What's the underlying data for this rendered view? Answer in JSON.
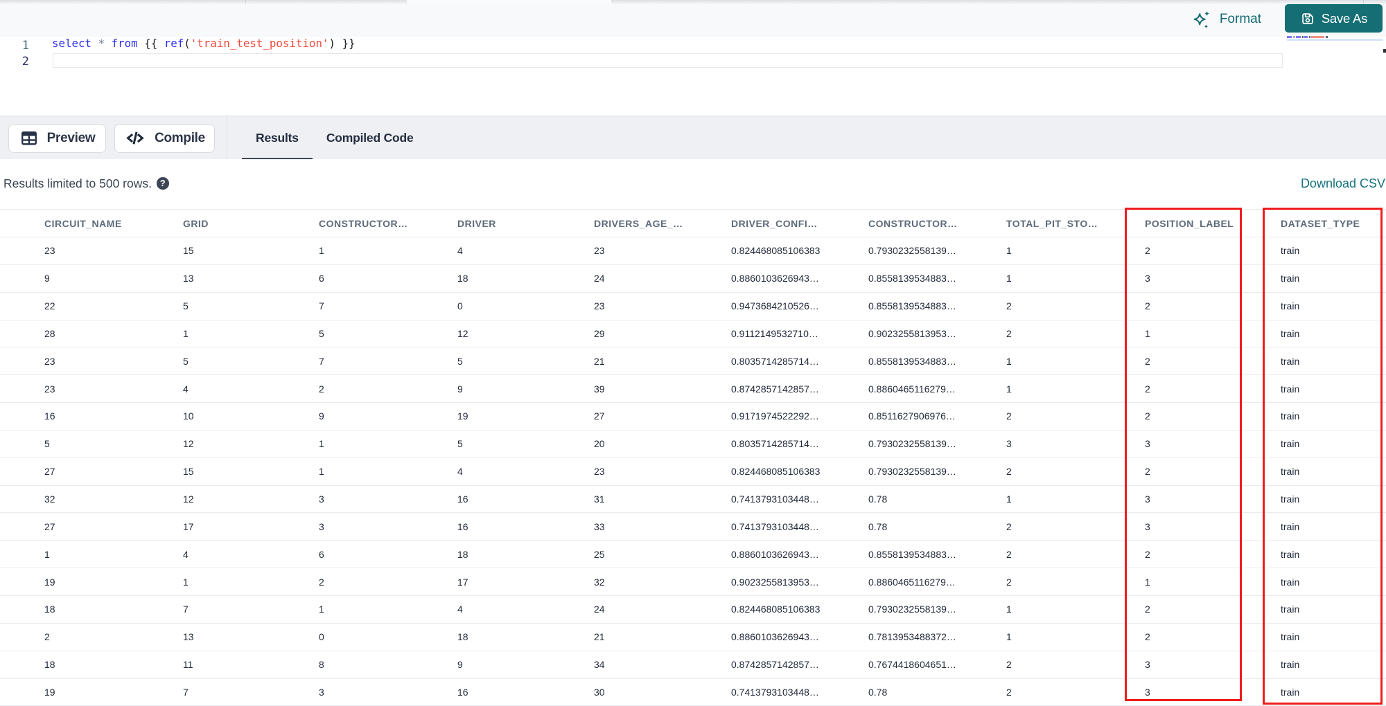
{
  "accent": {
    "teal": "#156e74",
    "red": "#ee1c1c"
  },
  "toolbar": {
    "format_label": "Format",
    "save_as_label": "Save As"
  },
  "editor": {
    "line_numbers": [
      "1",
      "2"
    ],
    "code_line": [
      {
        "text": "select",
        "type": "keyword"
      },
      {
        "text": " ",
        "type": "plain"
      },
      {
        "text": "*",
        "type": "operator"
      },
      {
        "text": " ",
        "type": "plain"
      },
      {
        "text": "from",
        "type": "keyword"
      },
      {
        "text": " ",
        "type": "plain"
      },
      {
        "text": "{{",
        "type": "brace"
      },
      {
        "text": " ",
        "type": "plain"
      },
      {
        "text": "ref",
        "type": "function"
      },
      {
        "text": "(",
        "type": "paren"
      },
      {
        "text": "'train_test_position'",
        "type": "string"
      },
      {
        "text": ")",
        "type": "paren"
      },
      {
        "text": " ",
        "type": "plain"
      },
      {
        "text": "}}",
        "type": "brace"
      }
    ]
  },
  "actions": {
    "preview_label": "Preview",
    "compile_label": "Compile"
  },
  "results_tabs": [
    {
      "label": "Results",
      "active": true
    },
    {
      "label": "Compiled Code",
      "active": false
    }
  ],
  "results_bar": {
    "note": "Results limited to 500 rows.",
    "help_glyph": "?",
    "download_label": "Download CSV"
  },
  "table": {
    "columns": [
      "CIRCUIT_NAME",
      "GRID",
      "CONSTRUCTOR…",
      "DRIVER",
      "DRIVERS_AGE_…",
      "DRIVER_CONFI…",
      "CONSTRUCTOR…",
      "TOTAL_PIT_STO…",
      "POSITION_LABEL",
      "DATASET_TYPE"
    ],
    "rows": [
      [
        "23",
        "15",
        "1",
        "4",
        "23",
        "0.824468085106383",
        "0.7930232558139…",
        "1",
        "2",
        "train"
      ],
      [
        "9",
        "13",
        "6",
        "18",
        "24",
        "0.8860103626943…",
        "0.8558139534883…",
        "1",
        "3",
        "train"
      ],
      [
        "22",
        "5",
        "7",
        "0",
        "23",
        "0.9473684210526…",
        "0.8558139534883…",
        "2",
        "2",
        "train"
      ],
      [
        "28",
        "1",
        "5",
        "12",
        "29",
        "0.9112149532710…",
        "0.9023255813953…",
        "2",
        "1",
        "train"
      ],
      [
        "23",
        "5",
        "7",
        "5",
        "21",
        "0.8035714285714…",
        "0.8558139534883…",
        "1",
        "2",
        "train"
      ],
      [
        "23",
        "4",
        "2",
        "9",
        "39",
        "0.8742857142857…",
        "0.8860465116279…",
        "1",
        "2",
        "train"
      ],
      [
        "16",
        "10",
        "9",
        "19",
        "27",
        "0.9171974522292…",
        "0.8511627906976…",
        "2",
        "2",
        "train"
      ],
      [
        "5",
        "12",
        "1",
        "5",
        "20",
        "0.8035714285714…",
        "0.7930232558139…",
        "3",
        "3",
        "train"
      ],
      [
        "27",
        "15",
        "1",
        "4",
        "23",
        "0.824468085106383",
        "0.7930232558139…",
        "2",
        "2",
        "train"
      ],
      [
        "32",
        "12",
        "3",
        "16",
        "31",
        "0.7413793103448…",
        "0.78",
        "1",
        "3",
        "train"
      ],
      [
        "27",
        "17",
        "3",
        "16",
        "33",
        "0.7413793103448…",
        "0.78",
        "2",
        "3",
        "train"
      ],
      [
        "1",
        "4",
        "6",
        "18",
        "25",
        "0.8860103626943…",
        "0.8558139534883…",
        "2",
        "2",
        "train"
      ],
      [
        "19",
        "1",
        "2",
        "17",
        "32",
        "0.9023255813953…",
        "0.8860465116279…",
        "2",
        "1",
        "train"
      ],
      [
        "18",
        "7",
        "1",
        "4",
        "24",
        "0.824468085106383",
        "0.7930232558139…",
        "1",
        "2",
        "train"
      ],
      [
        "2",
        "13",
        "0",
        "18",
        "21",
        "0.8860103626943…",
        "0.7813953488372…",
        "1",
        "2",
        "train"
      ],
      [
        "18",
        "11",
        "8",
        "9",
        "34",
        "0.8742857142857…",
        "0.7674418604651…",
        "2",
        "3",
        "train"
      ],
      [
        "19",
        "7",
        "3",
        "16",
        "30",
        "0.7413793103448…",
        "0.78",
        "2",
        "3",
        "train"
      ]
    ]
  },
  "annotations": {
    "highlighted_columns": [
      "POSITION_LABEL",
      "DATASET_TYPE"
    ]
  },
  "minimap": {
    "segments": [
      {
        "w": 7,
        "c": "#7b7bf0"
      },
      {
        "w": 3,
        "c": "#aab4c4"
      },
      {
        "w": 7,
        "c": "#7b7bf0"
      },
      {
        "w": 2,
        "c": "#5a6472"
      },
      {
        "w": 5,
        "c": "#7b7bf0"
      },
      {
        "w": 2,
        "c": "#5a6472"
      },
      {
        "w": 19,
        "c": "#f2918c"
      },
      {
        "w": 3,
        "c": "#5a6472"
      }
    ]
  }
}
